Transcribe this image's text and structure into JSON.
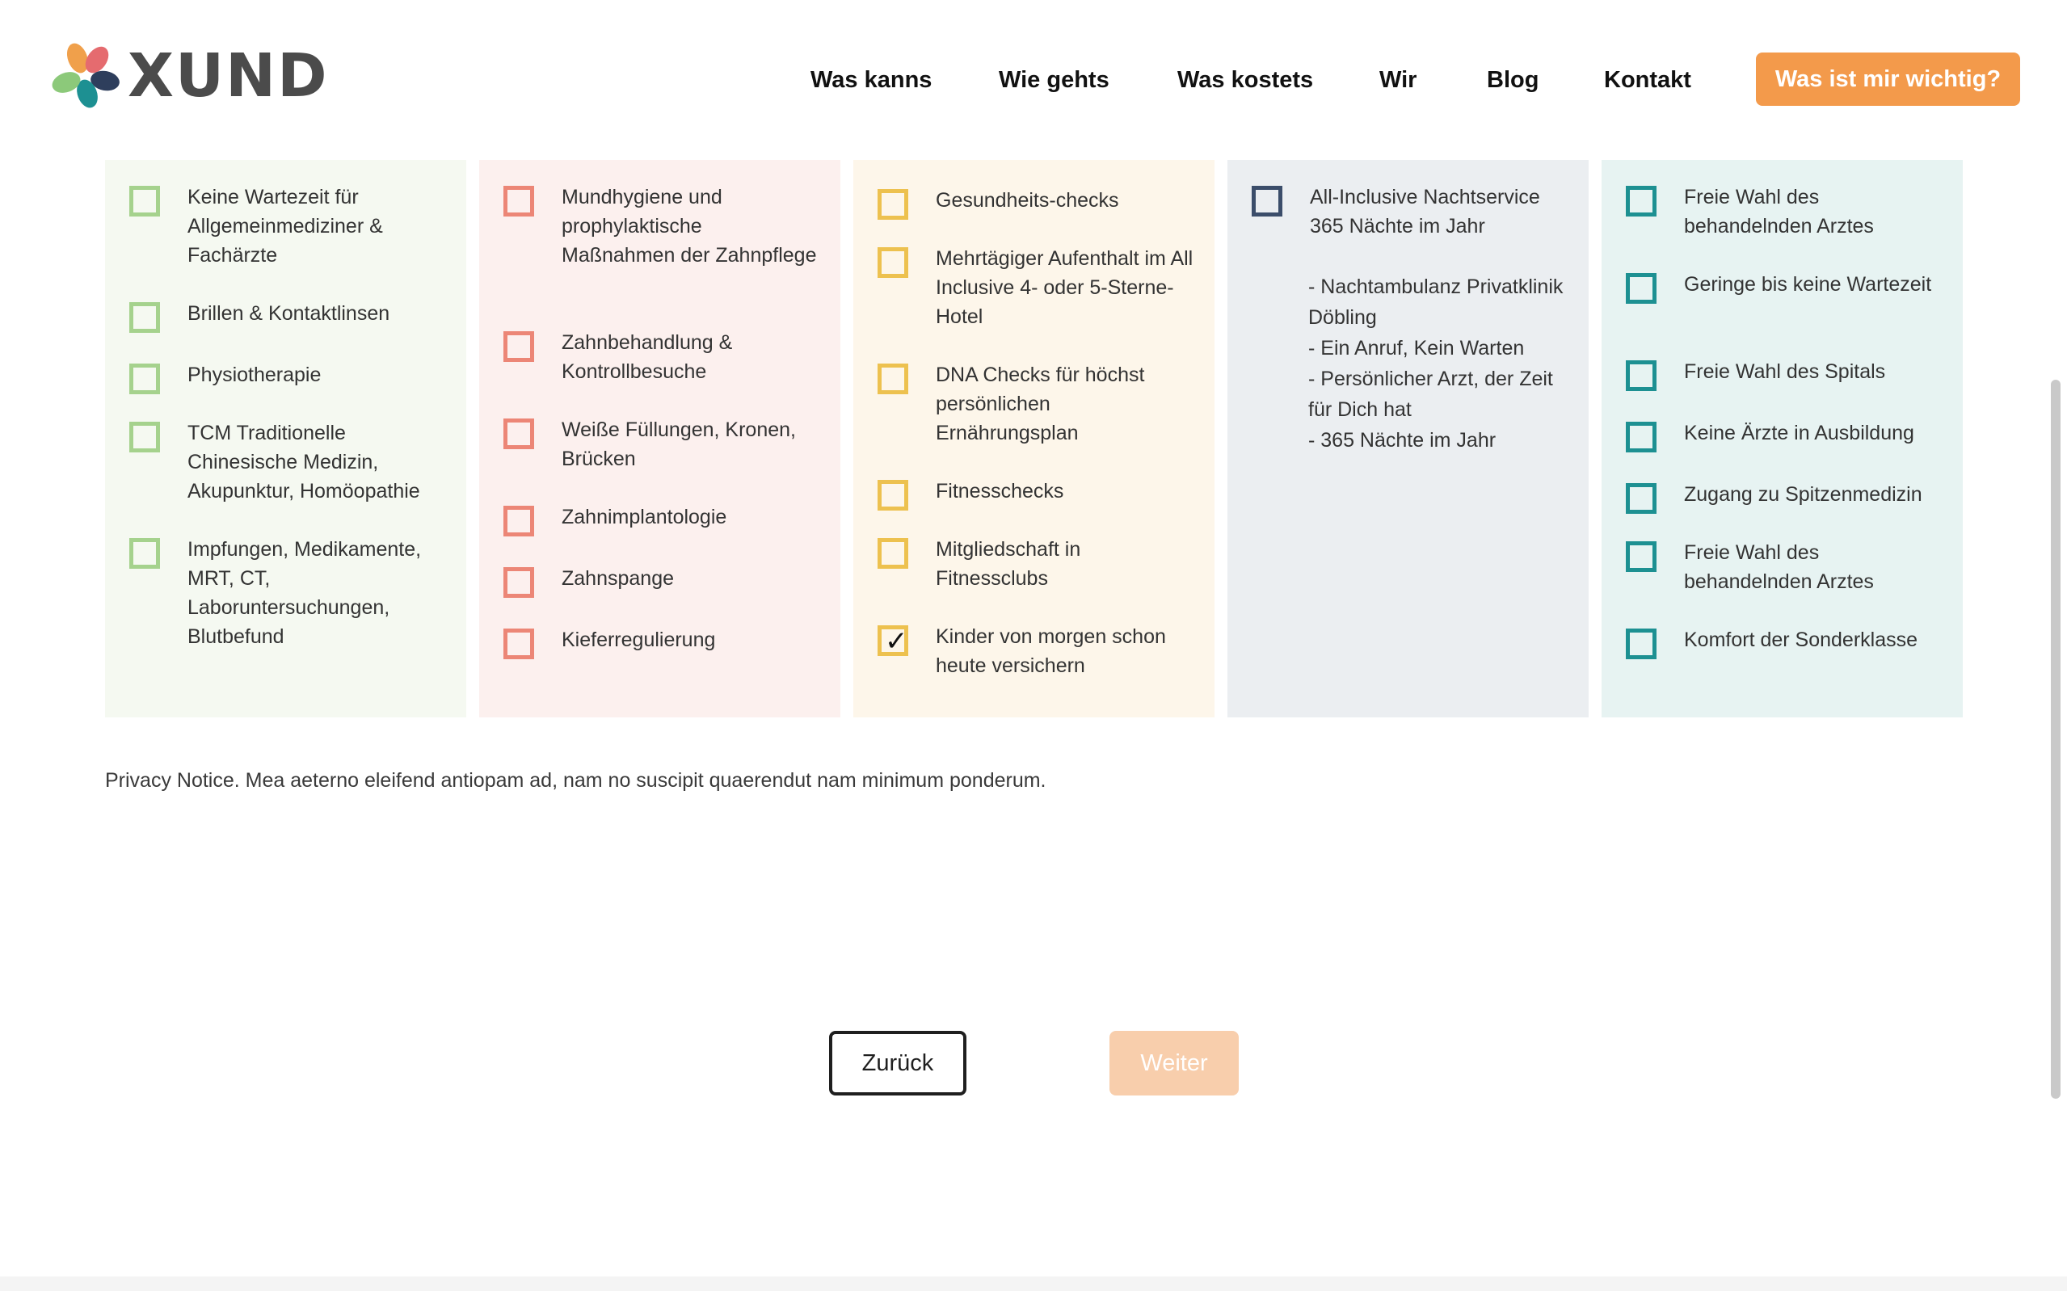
{
  "brand": {
    "name": "XUND",
    "accent": "#f39a4b"
  },
  "nav": {
    "items": [
      "Was kanns",
      "Wie gehts",
      "Was kostets",
      "Wir",
      "Blog",
      "Kontakt"
    ],
    "cta": "Was ist mir wichtig?"
  },
  "columns": [
    {
      "color": "#a5d28d",
      "items": [
        {
          "label": "Keine Wartezeit für Allgemeinmediziner & Fachärzte",
          "checked": false
        },
        {
          "label": "Brillen & Kontaktlinsen",
          "checked": false
        },
        {
          "label": "Physiotherapie",
          "checked": false
        },
        {
          "label": "TCM Traditionelle Chinesische Medizin, Akupunktur, Homöopathie",
          "checked": false
        },
        {
          "label": "Impfungen, Medikamente, MRT, CT, Laboruntersuchungen, Blutbefund",
          "checked": false
        }
      ]
    },
    {
      "color": "#ec8676",
      "items": [
        {
          "label": "Mundhygiene und prophylaktische Maßnahmen der Zahnpflege",
          "checked": false
        },
        {
          "label": "Zahnbehandlung & Kontrollbesuche",
          "checked": false
        },
        {
          "label": "Weiße Füllungen, Kronen, Brücken",
          "checked": false
        },
        {
          "label": "Zahnimplantologie",
          "checked": false
        },
        {
          "label": "Zahnspange",
          "checked": false
        },
        {
          "label": "Kieferregulierung",
          "checked": false
        }
      ]
    },
    {
      "color": "#edc14f",
      "items": [
        {
          "label": "Gesundheits-checks",
          "checked": false
        },
        {
          "label": "Mehrtägiger Aufenthalt im All Inclusive 4- oder 5-Sterne-Hotel",
          "checked": false
        },
        {
          "label": "DNA Checks für höchst persönlichen Ernährungsplan",
          "checked": false
        },
        {
          "label": "Fitnesschecks",
          "checked": false
        },
        {
          "label": "Mitgliedschaft in Fitnessclubs",
          "checked": false
        },
        {
          "label": "Kinder von morgen schon heute versichern",
          "checked": true
        }
      ]
    },
    {
      "color": "#3b4d6a",
      "items": [
        {
          "label": "All-Inclusive Nachtservice 365 Nächte im Jahr",
          "checked": false
        }
      ],
      "notes": [
        "- Nachtambulanz Privatklinik Döbling",
        "- Ein Anruf, Kein Warten",
        "- Persönlicher Arzt, der Zeit für Dich hat",
        "- 365 Nächte im Jahr"
      ]
    },
    {
      "color": "#1d9092",
      "items": [
        {
          "label": "Freie Wahl des behandelnden Arztes",
          "checked": false
        },
        {
          "label": "Geringe bis keine Wartezeit",
          "checked": false
        },
        {
          "label": "Freie Wahl des Spitals",
          "checked": false
        },
        {
          "label": "Keine Ärzte in Ausbildung",
          "checked": false
        },
        {
          "label": "Zugang zu Spitzenmedizin",
          "checked": false
        },
        {
          "label": "Freie Wahl des behandelnden Arztes",
          "checked": false
        },
        {
          "label": "Komfort der Sonderklasse",
          "checked": false
        }
      ]
    }
  ],
  "privacy": "Privacy Notice. Mea aeterno eleifend antiopam ad, nam no suscipit quaerendut nam minimum ponderum.",
  "buttons": {
    "back": "Zurück",
    "next": "Weiter"
  }
}
